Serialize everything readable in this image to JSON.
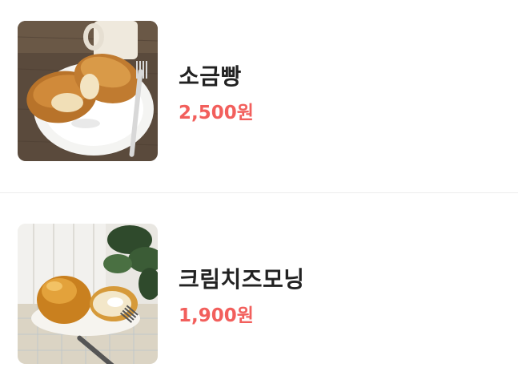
{
  "items": [
    {
      "image_icon": "salt-bread-photo",
      "name": "소금빵",
      "price": "2,500원"
    },
    {
      "image_icon": "cream-cheese-morning-bread-photo",
      "name": "크림치즈모닝",
      "price": "1,900원"
    }
  ],
  "colors": {
    "price": "#f25f5c",
    "name": "#222222",
    "divider": "#ececec"
  }
}
